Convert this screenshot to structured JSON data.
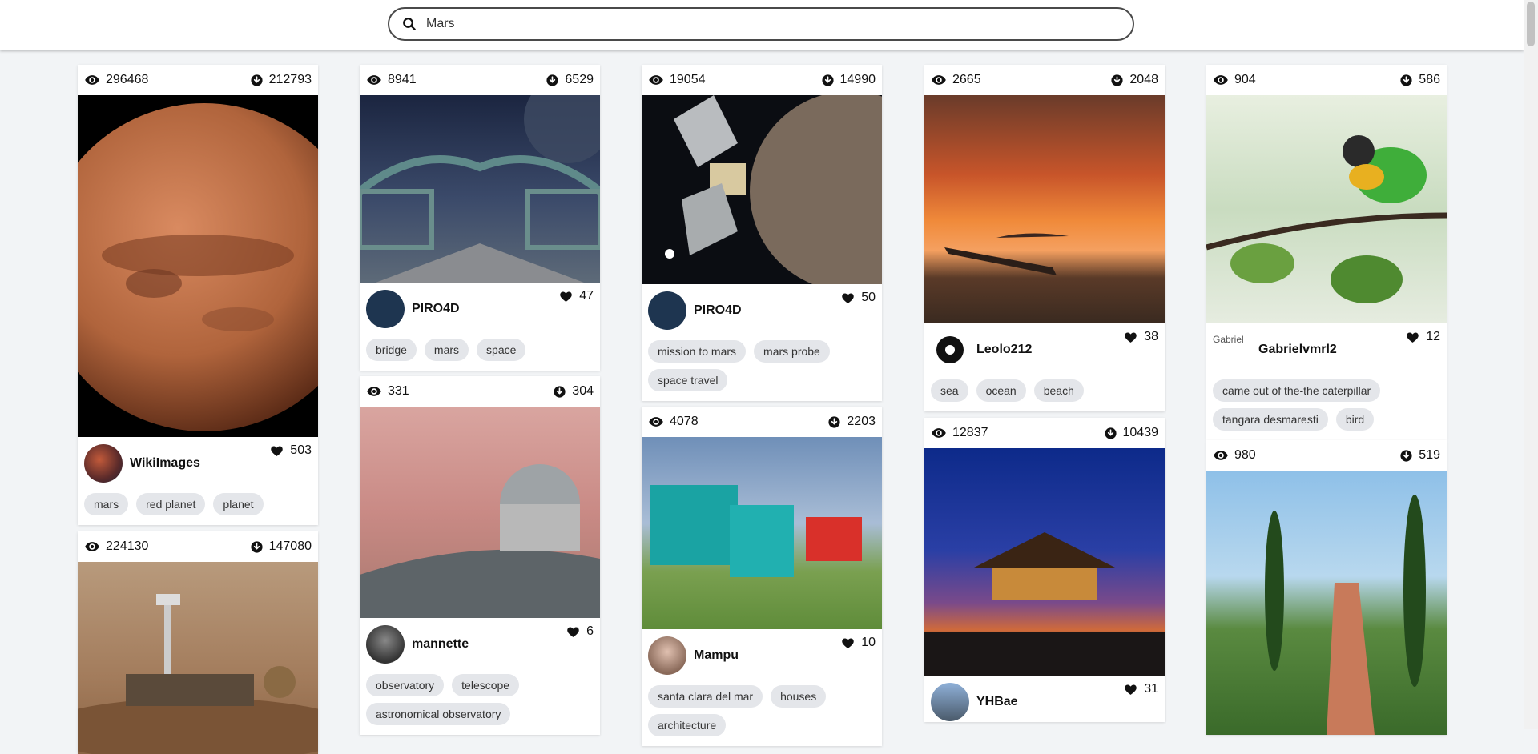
{
  "search": {
    "value": "Mars",
    "placeholder": ""
  },
  "cards": [
    {
      "views": "296468",
      "downloads": "212793",
      "author": "WikiImages",
      "likes": "503",
      "tags": [
        "mars",
        "red planet",
        "planet"
      ]
    },
    {
      "views": "224130",
      "downloads": "147080"
    },
    {
      "views": "8941",
      "downloads": "6529",
      "author": "PIRO4D",
      "likes": "47",
      "tags": [
        "bridge",
        "mars",
        "space"
      ]
    },
    {
      "views": "331",
      "downloads": "304",
      "author": "mannette",
      "likes": "6",
      "tags": [
        "observatory",
        "telescope",
        "astronomical observatory"
      ]
    },
    {
      "views": "19054",
      "downloads": "14990",
      "author": "PIRO4D",
      "likes": "50",
      "tags": [
        "mission to mars",
        "mars probe",
        "space travel"
      ]
    },
    {
      "views": "4078",
      "downloads": "2203",
      "author": "Mampu",
      "likes": "10",
      "tags": [
        "santa clara del mar",
        "houses",
        "architecture"
      ]
    },
    {
      "views": "2665",
      "downloads": "2048",
      "author": "Leolo212",
      "likes": "38",
      "tags": [
        "sea",
        "ocean",
        "beach"
      ]
    },
    {
      "views": "12837",
      "downloads": "10439",
      "author": "YHBae",
      "likes": "31"
    },
    {
      "views": "904",
      "downloads": "586",
      "author": "Gabrielvmrl2",
      "avatar_alt": "Gabriel",
      "likes": "12",
      "tags": [
        "came out of the-the caterpillar",
        "tangara desmaresti",
        "bird"
      ]
    },
    {
      "views": "980",
      "downloads": "519"
    }
  ],
  "icons": {
    "views": "eye-icon",
    "downloads": "download-icon",
    "likes": "heart-icon",
    "search": "search-icon"
  }
}
